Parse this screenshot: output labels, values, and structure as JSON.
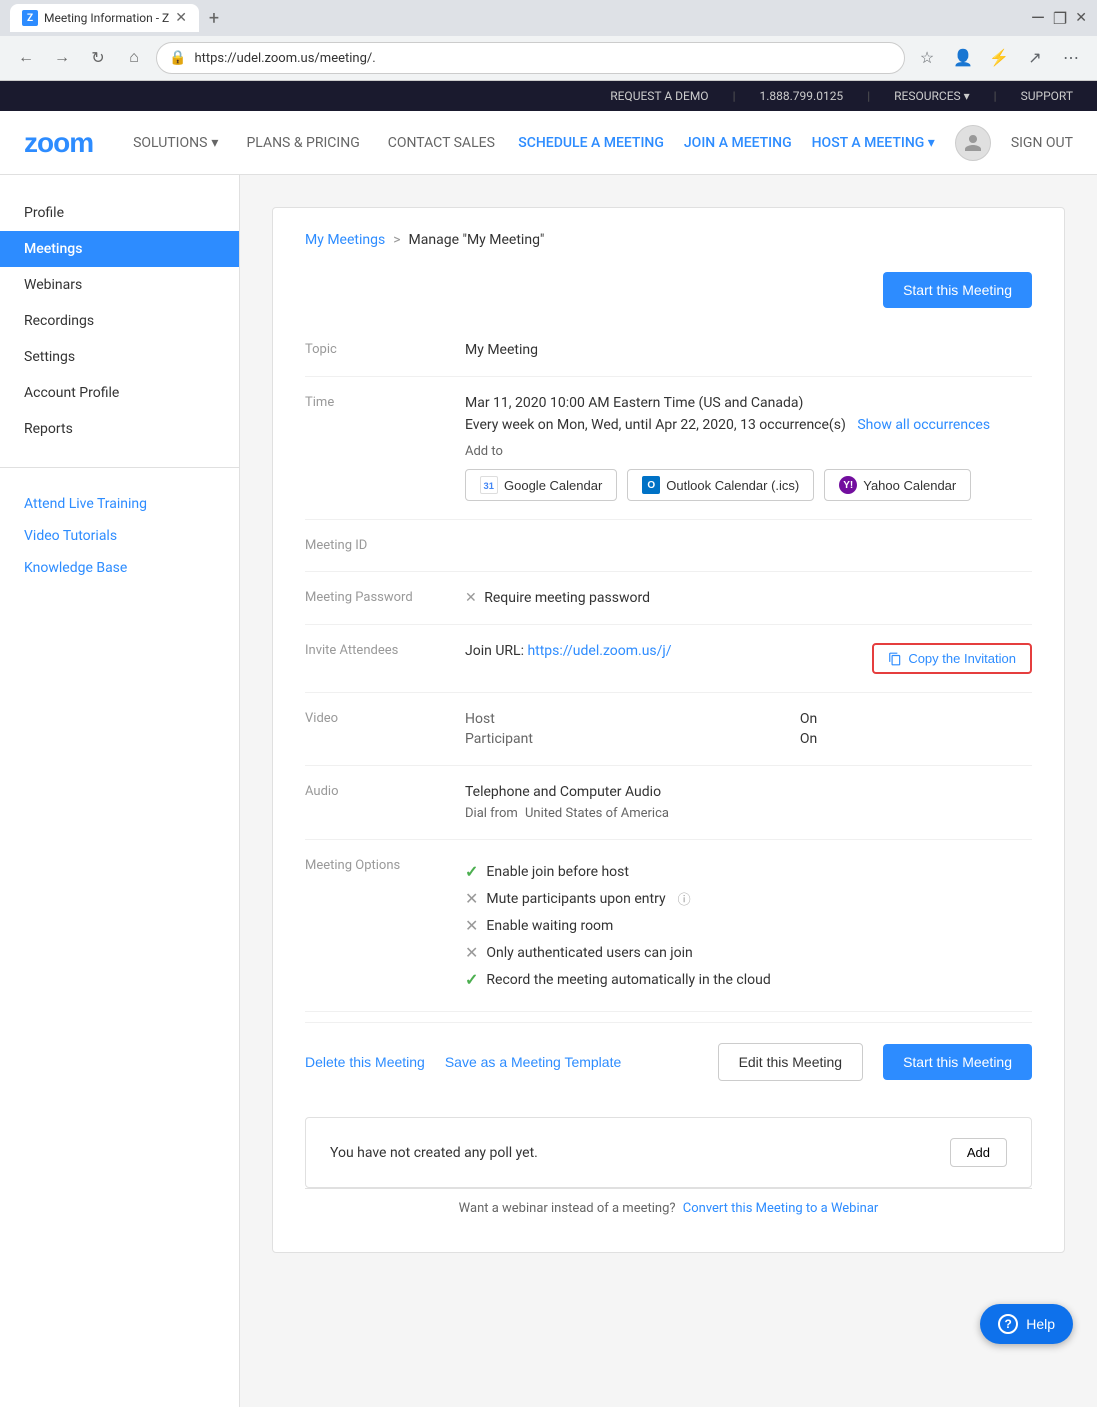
{
  "browser": {
    "tab_title": "Meeting Information - Z",
    "url": "https://udel.zoom.us/meeting/.",
    "favicon_color": "#2d8cff"
  },
  "topbar": {
    "request_demo": "REQUEST A DEMO",
    "phone": "1.888.799.0125",
    "resources": "RESOURCES",
    "support": "SUPPORT"
  },
  "header": {
    "logo": "zoom",
    "nav": [
      {
        "label": "SOLUTIONS",
        "has_arrow": true
      },
      {
        "label": "PLANS & PRICING",
        "has_arrow": false
      },
      {
        "label": "CONTACT SALES",
        "has_arrow": false
      }
    ],
    "actions": [
      {
        "label": "SCHEDULE A MEETING"
      },
      {
        "label": "JOIN A MEETING"
      },
      {
        "label": "HOST A MEETING",
        "has_arrow": true
      }
    ],
    "sign_out": "SIGN OUT"
  },
  "sidebar": {
    "items": [
      {
        "label": "Profile",
        "active": false
      },
      {
        "label": "Meetings",
        "active": true
      },
      {
        "label": "Webinars",
        "active": false
      },
      {
        "label": "Recordings",
        "active": false
      },
      {
        "label": "Settings",
        "active": false
      },
      {
        "label": "Account Profile",
        "active": false
      },
      {
        "label": "Reports",
        "active": false
      }
    ],
    "links": [
      {
        "label": "Attend Live Training"
      },
      {
        "label": "Video Tutorials"
      },
      {
        "label": "Knowledge Base"
      }
    ]
  },
  "breadcrumb": {
    "parent": "My Meetings",
    "separator": ">",
    "current": "Manage \"My Meeting\""
  },
  "meeting": {
    "start_button": "Start this Meeting",
    "topic_label": "Topic",
    "topic_value": "My Meeting",
    "time_label": "Time",
    "time_value": "Mar 11, 2020 10:00 AM Eastern Time (US and Canada)",
    "recurrence_value": "Every week on Mon, Wed, until Apr 22, 2020, 13 occurrence(s)",
    "show_all": "Show all occurrences",
    "add_to": "Add to",
    "google_calendar": "Google Calendar",
    "outlook_calendar": "Outlook Calendar (.ics)",
    "yahoo_calendar": "Yahoo Calendar",
    "meeting_id_label": "Meeting ID",
    "meeting_id_value": "",
    "password_label": "Meeting Password",
    "password_value": "Require meeting password",
    "password_icon": "×",
    "invite_label": "Invite Attendees",
    "join_url_prefix": "Join URL:",
    "join_url": "https://udel.zoom.us/j/",
    "copy_invitation": "Copy the Invitation",
    "video_label": "Video",
    "video_host_label": "Host",
    "video_host_value": "On",
    "video_participant_label": "Participant",
    "video_participant_value": "On",
    "audio_label": "Audio",
    "audio_value": "Telephone and Computer Audio",
    "dial_prefix": "Dial from",
    "dial_value": "United States of America",
    "options_label": "Meeting Options",
    "options": [
      {
        "icon": "check",
        "text": "Enable join before host",
        "note": ""
      },
      {
        "icon": "cross",
        "text": "Mute participants upon entry",
        "note": "ℹ"
      },
      {
        "icon": "cross",
        "text": "Enable waiting room",
        "note": ""
      },
      {
        "icon": "cross",
        "text": "Only authenticated users can join",
        "note": ""
      },
      {
        "icon": "check",
        "text": "Record the meeting automatically in the cloud",
        "note": ""
      }
    ],
    "delete_btn": "Delete this Meeting",
    "save_template_btn": "Save as a Meeting Template",
    "edit_btn": "Edit this Meeting",
    "start_btn_bottom": "Start this Meeting"
  },
  "poll": {
    "message": "You have not created any poll yet.",
    "add_btn": "Add"
  },
  "footer": {
    "webinar_text": "Want a webinar instead of a meeting?",
    "webinar_link": "Convert this Meeting to a Webinar"
  },
  "help": {
    "label": "Help"
  }
}
